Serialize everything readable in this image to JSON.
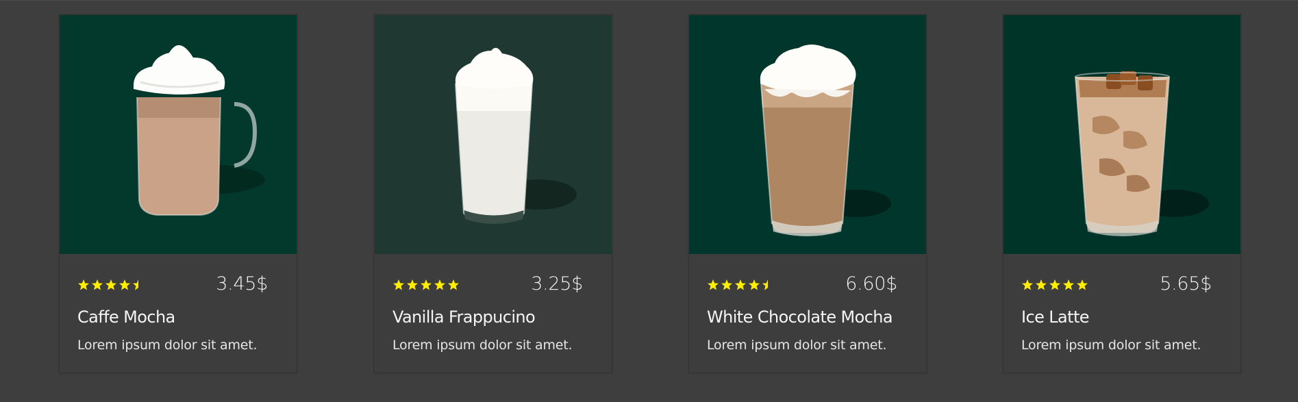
{
  "products": [
    {
      "name": "Caffe Mocha",
      "price": "3.45$",
      "rating": 4.5,
      "description": "Lorem ipsum dolor sit amet.",
      "image_bg": "#03382c",
      "drink": "mocha-mug"
    },
    {
      "name": "Vanilla Frappucino",
      "price": "3.25$",
      "rating": 5,
      "description": "Lorem ipsum dolor sit amet.",
      "image_bg": "#1f3832",
      "drink": "vanilla-glass"
    },
    {
      "name": "White Chocolate Mocha",
      "price": "6.60$",
      "rating": 4.5,
      "description": "Lorem ipsum dolor sit amet.",
      "image_bg": "#00362b",
      "drink": "white-mocha-glass"
    },
    {
      "name": "Ice Latte",
      "price": "5.65$",
      "rating": 5,
      "description": "Lorem ipsum dolor sit amet.",
      "image_bg": "#013429",
      "drink": "iced-latte-glass"
    }
  ],
  "colors": {
    "page_bg": "#3e3e3e",
    "star": "#ffee00",
    "text": "#f5f5f5"
  }
}
